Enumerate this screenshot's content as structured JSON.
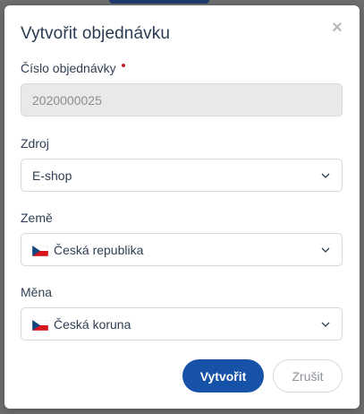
{
  "dialog": {
    "title": "Vytvořit objednávku",
    "close_symbol": "×"
  },
  "fields": {
    "order_number": {
      "label": "Číslo objednávky",
      "value": "2020000025",
      "required": true,
      "disabled": true
    },
    "source": {
      "label": "Zdroj",
      "value": "E-shop"
    },
    "country": {
      "label": "Země",
      "value": "Česká republika",
      "flag_icon": "czech-flag-icon"
    },
    "currency": {
      "label": "Měna",
      "value": "Česká koruna",
      "flag_icon": "czech-flag-icon"
    }
  },
  "actions": {
    "create_label": "Vytvořit",
    "cancel_label": "Zrušit"
  },
  "colors": {
    "primary": "#1652a7",
    "required_marker": "#c0222b",
    "text": "#2f3e52",
    "overlay": "#6f6f70"
  }
}
